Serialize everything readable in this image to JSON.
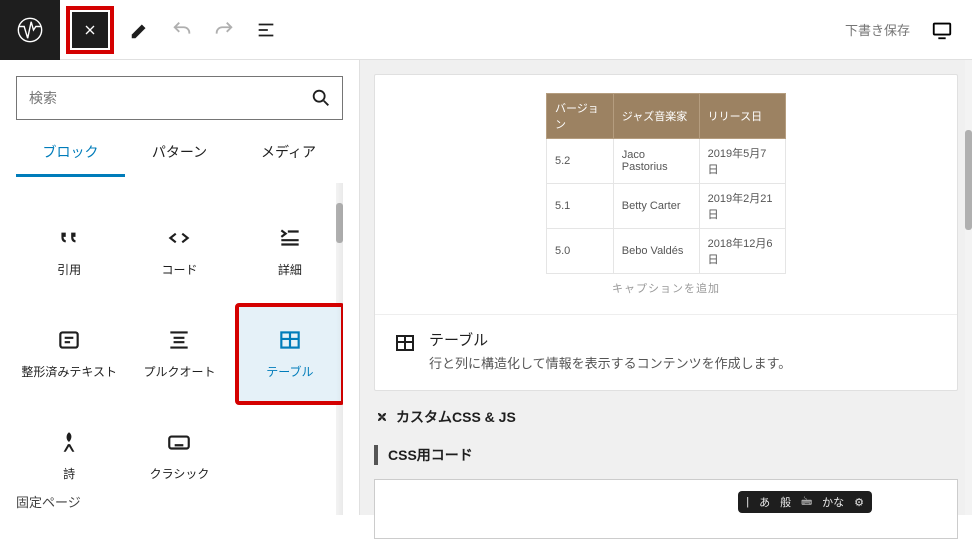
{
  "topbar": {
    "draft_save": "下書き保存"
  },
  "search": {
    "placeholder": "検索"
  },
  "tabs": [
    "ブロック",
    "パターン",
    "メディア"
  ],
  "blocks": [
    {
      "label": "引用",
      "icon": "quote"
    },
    {
      "label": "コード",
      "icon": "code"
    },
    {
      "label": "詳細",
      "icon": "details"
    },
    {
      "label": "整形済みテキスト",
      "icon": "pre"
    },
    {
      "label": "プルクオート",
      "icon": "pullquote"
    },
    {
      "label": "テーブル",
      "icon": "table",
      "selected": true
    },
    {
      "label": "詩",
      "icon": "verse"
    },
    {
      "label": "クラシック",
      "icon": "keyboard"
    }
  ],
  "footer_pin": "固定ページ",
  "preview": {
    "headers": [
      "バージョン",
      "ジャズ音楽家",
      "リリース日"
    ],
    "rows": [
      [
        "5.2",
        "Jaco Pastorius",
        "2019年5月7日"
      ],
      [
        "5.1",
        "Betty Carter",
        "2019年2月21日"
      ],
      [
        "5.0",
        "Bebo Valdés",
        "2018年12月6日"
      ]
    ],
    "caption": "キャプションを追加",
    "block_title": "テーブル",
    "block_desc": "行と列に構造化して情報を表示するコンテンツを作成します。"
  },
  "sections": {
    "customcss": "カスタムCSS & JS",
    "css_code": "CSS用コード"
  },
  "ime": [
    "|",
    "あ",
    "般",
    "🖮",
    "かな",
    "⚙"
  ]
}
